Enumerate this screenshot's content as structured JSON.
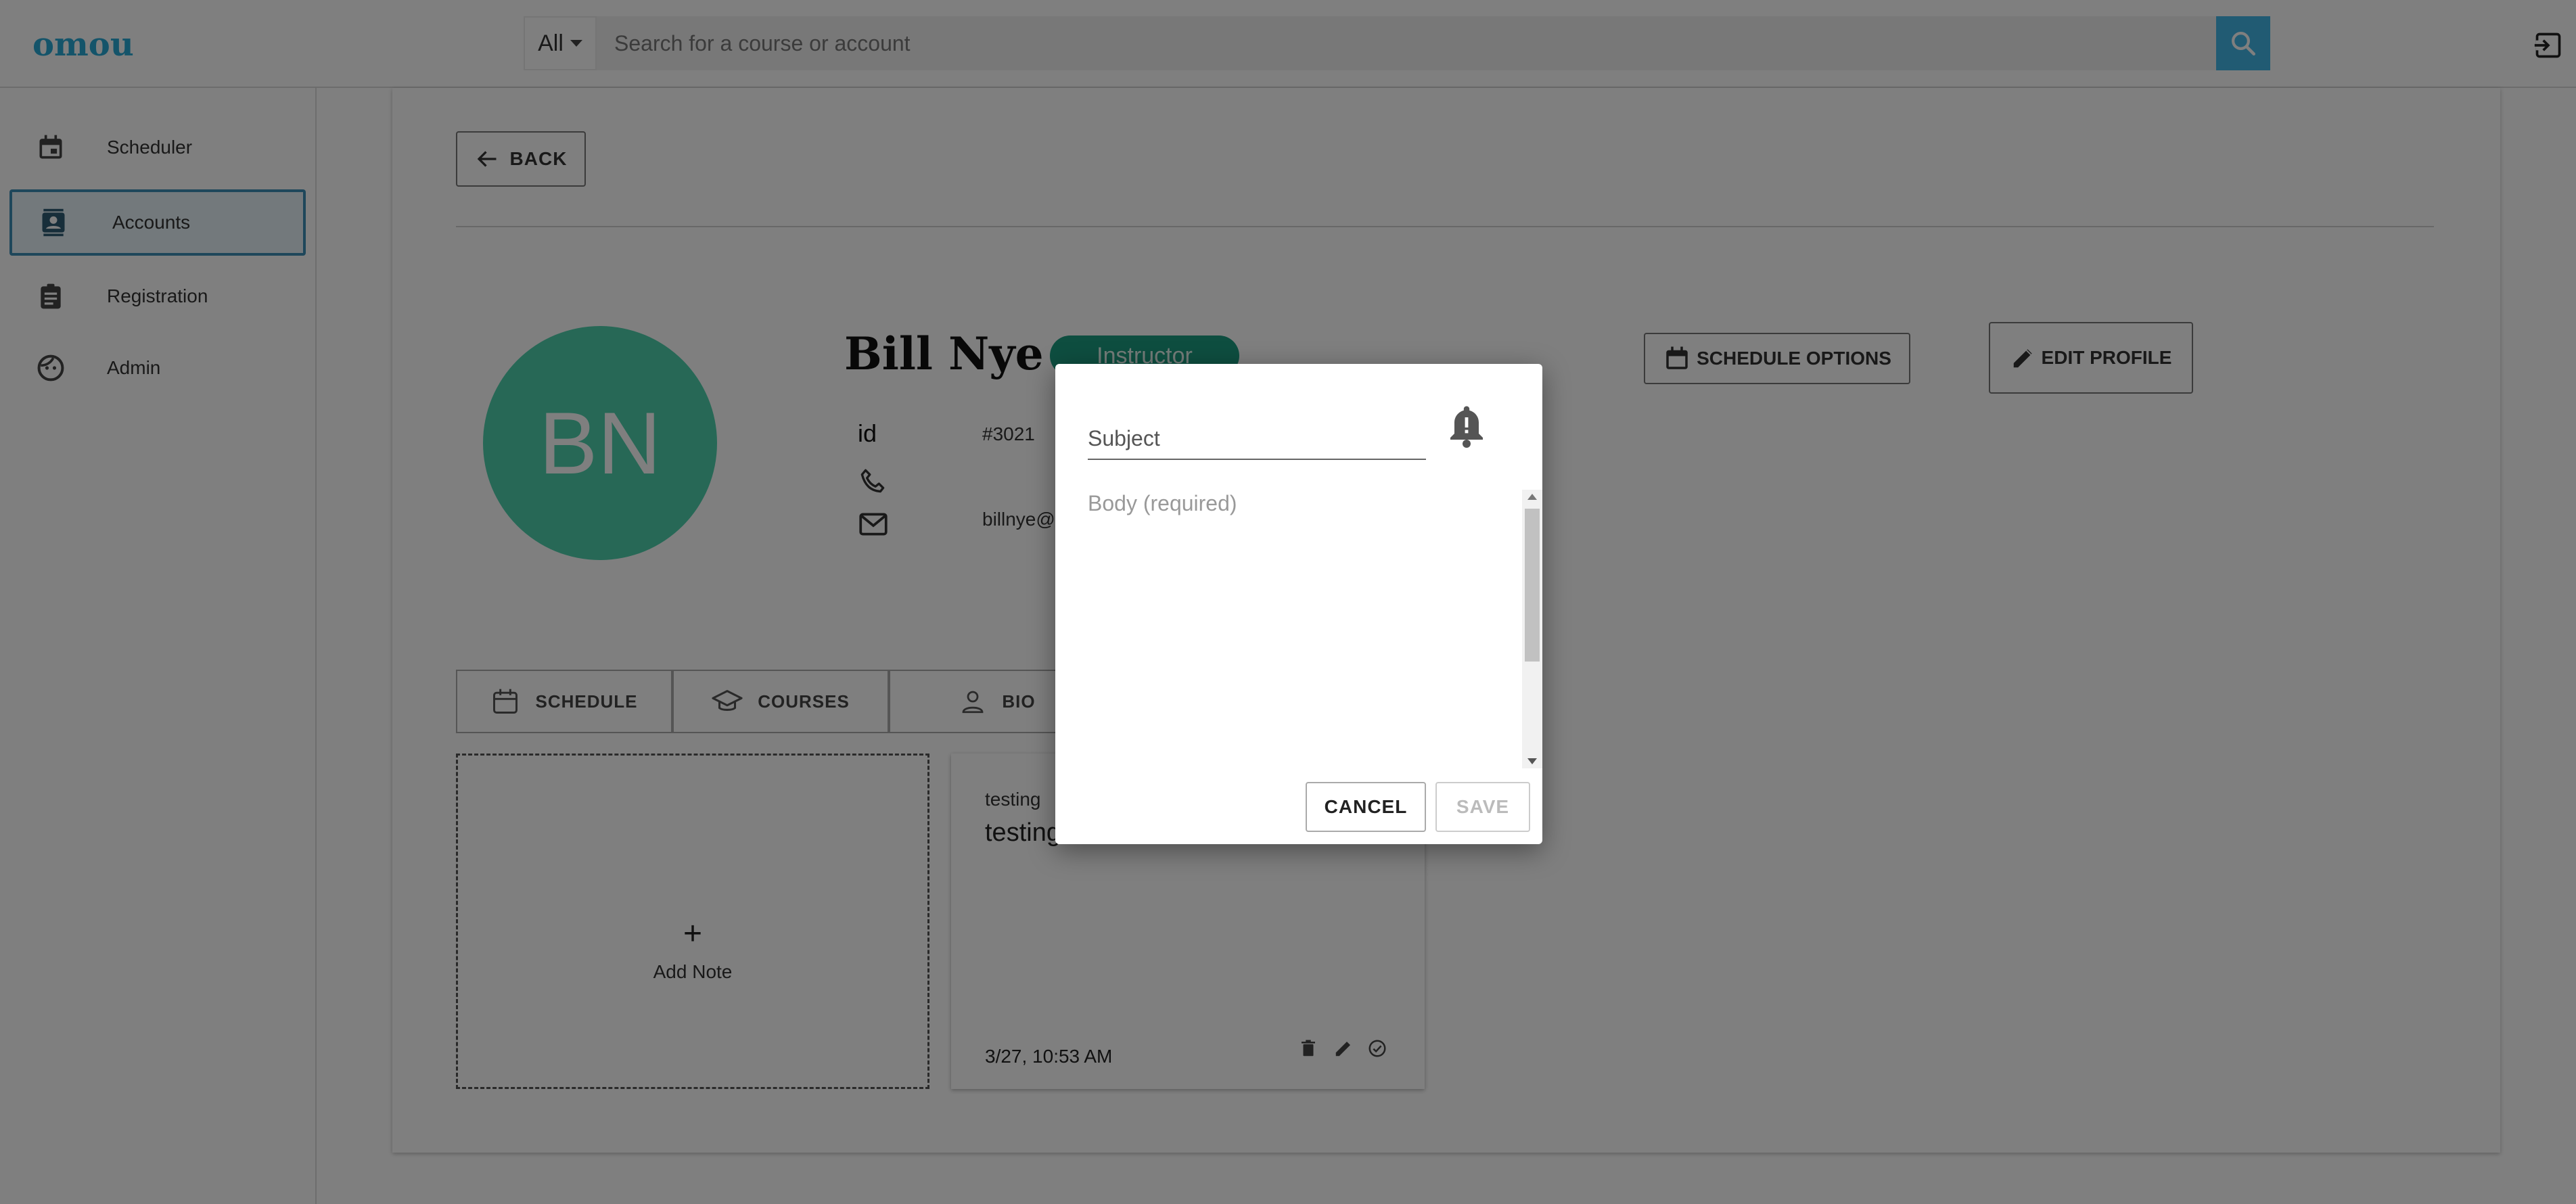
{
  "app": {
    "logo": "omou"
  },
  "search": {
    "filter_label": "All",
    "placeholder": "Search for a course or account"
  },
  "sidebar": {
    "items": [
      {
        "label": "Scheduler",
        "icon": "calendar-icon"
      },
      {
        "label": "Accounts",
        "icon": "contacts-icon",
        "active": true
      },
      {
        "label": "Registration",
        "icon": "clipboard-icon"
      },
      {
        "label": "Admin",
        "icon": "face-icon"
      }
    ]
  },
  "profile": {
    "back_label": "BACK",
    "initials": "BN",
    "name": "Bill Nye",
    "role": "Instructor",
    "id_label": "id",
    "id_value": "#3021",
    "email_partial": "billnye@",
    "schedule_options_label": "SCHEDULE OPTIONS",
    "edit_profile_label": "EDIT PROFILE"
  },
  "tabs": [
    {
      "label": "SCHEDULE",
      "icon": "calendar-icon"
    },
    {
      "label": "COURSES",
      "icon": "school-icon"
    },
    {
      "label": "BIO",
      "icon": "person-icon"
    }
  ],
  "notes": {
    "add_label": "Add Note",
    "add_symbol": "+",
    "items": [
      {
        "subject": "testing",
        "body": "testing",
        "date": "3/27, 10:53 AM"
      }
    ]
  },
  "dialog": {
    "subject_placeholder": "Subject",
    "body_placeholder": "Body (required)",
    "cancel_label": "CANCEL",
    "save_label": "SAVE"
  },
  "colors": {
    "brand": "#28a9d4",
    "search_button": "#43b6e6",
    "avatar": "#4fd0ad",
    "role_badge": "#1c9c81",
    "active_nav_border": "#3d8fb7"
  }
}
